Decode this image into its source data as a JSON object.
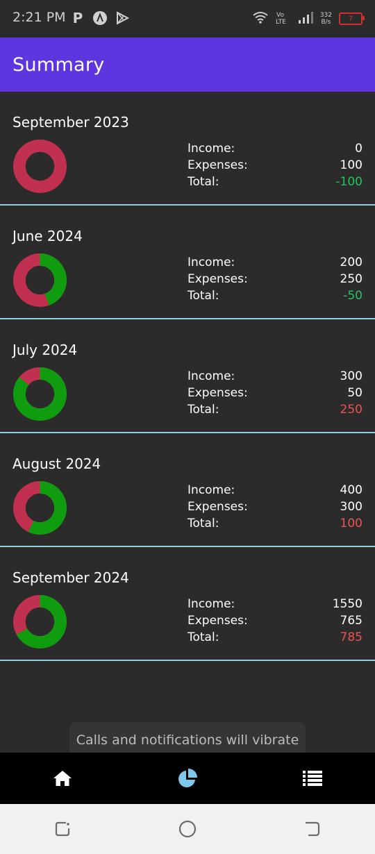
{
  "status_bar": {
    "time": "2:21 PM",
    "left_icons": [
      "parking-icon",
      "app-logo-icon",
      "play-store-icon"
    ],
    "right_icons": [
      "wifi-icon",
      "volte-icon",
      "signal-icon"
    ],
    "net_speed_value": "332",
    "net_speed_unit": "B/s",
    "battery_level": "7"
  },
  "app_bar": {
    "title": "Summary"
  },
  "labels": {
    "income": "Income:",
    "expenses": "Expenses:",
    "total": "Total:"
  },
  "colors": {
    "app_bar": "#5e35de",
    "income_ring": "#0f9d0f",
    "expense_ring": "#c2304f",
    "total_green": "#22c55e",
    "total_red": "#ef5350",
    "divider": "#8ecfe0",
    "nav_active": "#7dc8ec"
  },
  "months": [
    {
      "title": "September 2023",
      "income": "0",
      "expenses": "100",
      "total": "-100",
      "income_value": 0,
      "expenses_value": 100
    },
    {
      "title": "June 2024",
      "income": "200",
      "expenses": "250",
      "total": "-50",
      "income_value": 200,
      "expenses_value": 250
    },
    {
      "title": "July 2024",
      "income": "300",
      "expenses": "50",
      "total": "250",
      "income_value": 300,
      "expenses_value": 50
    },
    {
      "title": "August 2024",
      "income": "400",
      "expenses": "300",
      "total": "100",
      "income_value": 400,
      "expenses_value": 300
    },
    {
      "title": "September 2024",
      "income": "1550",
      "expenses": "765",
      "total": "785",
      "income_value": 1550,
      "expenses_value": 765
    }
  ],
  "toast": {
    "message": "Calls and notifications will vibrate"
  },
  "bottom_nav": {
    "items": [
      {
        "icon": "home-icon",
        "active": false
      },
      {
        "icon": "pie-chart-icon",
        "active": true
      },
      {
        "icon": "list-icon",
        "active": false
      }
    ]
  },
  "system_nav": {
    "items": [
      "recent-apps-icon",
      "home-circle-icon",
      "back-icon"
    ]
  }
}
